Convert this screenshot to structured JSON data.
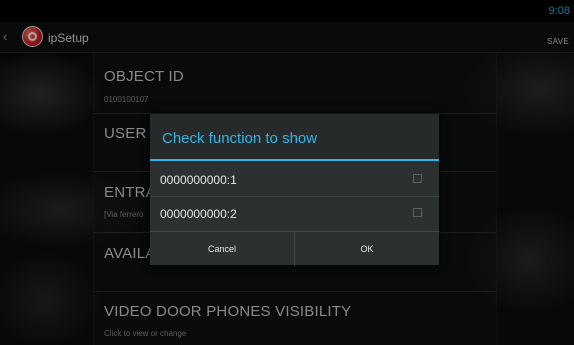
{
  "status_bar": {
    "time": "9:08"
  },
  "action_bar": {
    "title": "ipSetup",
    "save_label": "SAVE",
    "up_glyph": "‹"
  },
  "preferences": [
    {
      "title": "OBJECT ID",
      "summary": "0100100107"
    },
    {
      "title": "USER N",
      "summary": ""
    },
    {
      "title": "ENTRA",
      "summary": "[Via ferrero"
    },
    {
      "title": "AVAILA",
      "summary": ""
    },
    {
      "title": "VIDEO DOOR PHONES VISIBILITY",
      "summary": "Click to view or change"
    }
  ],
  "dialog": {
    "title": "Check function to show",
    "options": [
      {
        "label": "0000000000:1",
        "checked": false
      },
      {
        "label": "0000000000:2",
        "checked": false
      }
    ],
    "cancel_label": "Cancel",
    "ok_label": "OK"
  },
  "colors": {
    "accent": "#33b5e5",
    "dialog_bg": "#2d3030",
    "action_bar": "#0f1111"
  },
  "icons": {
    "app": "ipsetup-app-icon",
    "up": "chevron-left-icon",
    "checkbox": "checkbox-icon"
  }
}
